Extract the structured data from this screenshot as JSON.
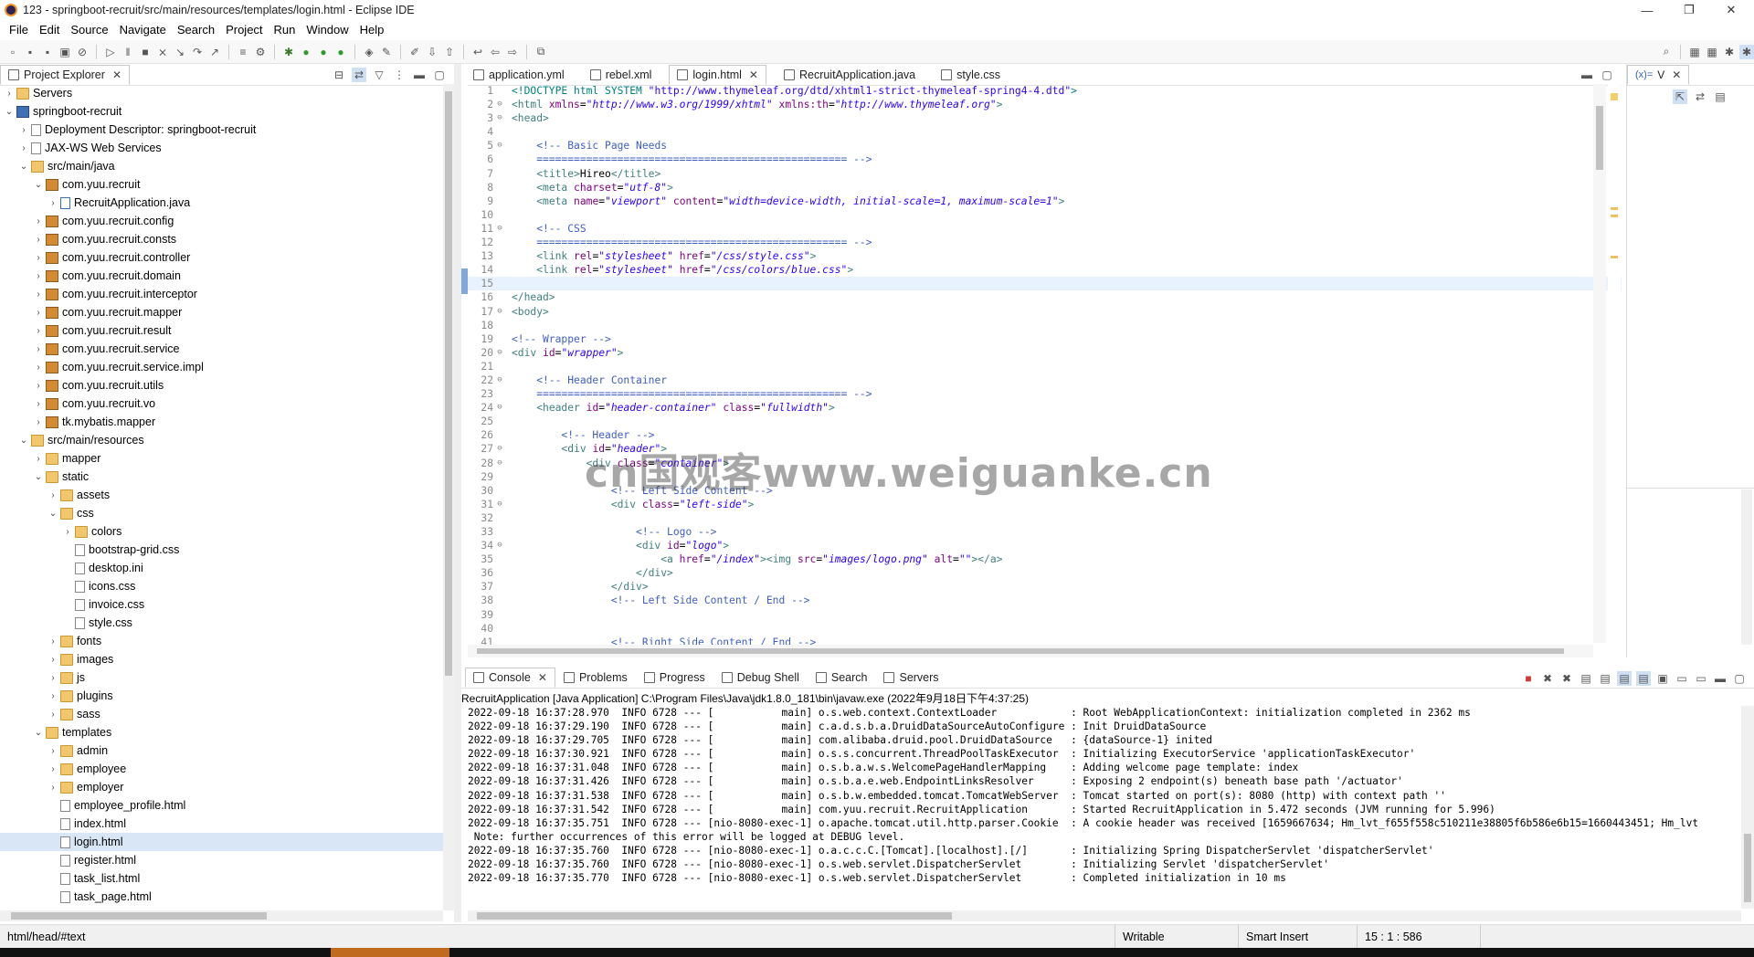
{
  "window": {
    "title": "123 - springboot-recruit/src/main/resources/templates/login.html - Eclipse IDE"
  },
  "menu": [
    "File",
    "Edit",
    "Source",
    "Navigate",
    "Search",
    "Project",
    "Run",
    "Window",
    "Help"
  ],
  "project_explorer": {
    "tab_label": "Project Explorer",
    "rows": [
      {
        "label": "Servers",
        "indent": 0,
        "arrow": "›",
        "icon": "folder"
      },
      {
        "label": "springboot-recruit",
        "indent": 0,
        "arrow": "⌄",
        "icon": "proj"
      },
      {
        "label": "Deployment Descriptor: springboot-recruit",
        "indent": 1,
        "arrow": "›",
        "icon": "file"
      },
      {
        "label": "JAX-WS Web Services",
        "indent": 1,
        "arrow": "›",
        "icon": "file"
      },
      {
        "label": "src/main/java",
        "indent": 1,
        "arrow": "⌄",
        "icon": "src"
      },
      {
        "label": "com.yuu.recruit",
        "indent": 2,
        "arrow": "⌄",
        "icon": "pkg"
      },
      {
        "label": "RecruitApplication.java",
        "indent": 3,
        "arrow": "›",
        "icon": "java"
      },
      {
        "label": "com.yuu.recruit.config",
        "indent": 2,
        "arrow": "›",
        "icon": "pkg"
      },
      {
        "label": "com.yuu.recruit.consts",
        "indent": 2,
        "arrow": "›",
        "icon": "pkg"
      },
      {
        "label": "com.yuu.recruit.controller",
        "indent": 2,
        "arrow": "›",
        "icon": "pkg"
      },
      {
        "label": "com.yuu.recruit.domain",
        "indent": 2,
        "arrow": "›",
        "icon": "pkg"
      },
      {
        "label": "com.yuu.recruit.interceptor",
        "indent": 2,
        "arrow": "›",
        "icon": "pkg"
      },
      {
        "label": "com.yuu.recruit.mapper",
        "indent": 2,
        "arrow": "›",
        "icon": "pkg"
      },
      {
        "label": "com.yuu.recruit.result",
        "indent": 2,
        "arrow": "›",
        "icon": "pkg"
      },
      {
        "label": "com.yuu.recruit.service",
        "indent": 2,
        "arrow": "›",
        "icon": "pkg"
      },
      {
        "label": "com.yuu.recruit.service.impl",
        "indent": 2,
        "arrow": "›",
        "icon": "pkg"
      },
      {
        "label": "com.yuu.recruit.utils",
        "indent": 2,
        "arrow": "›",
        "icon": "pkg"
      },
      {
        "label": "com.yuu.recruit.vo",
        "indent": 2,
        "arrow": "›",
        "icon": "pkg"
      },
      {
        "label": "tk.mybatis.mapper",
        "indent": 2,
        "arrow": "›",
        "icon": "pkg"
      },
      {
        "label": "src/main/resources",
        "indent": 1,
        "arrow": "⌄",
        "icon": "src"
      },
      {
        "label": "mapper",
        "indent": 2,
        "arrow": "›",
        "icon": "folder"
      },
      {
        "label": "static",
        "indent": 2,
        "arrow": "⌄",
        "icon": "folder"
      },
      {
        "label": "assets",
        "indent": 3,
        "arrow": "›",
        "icon": "folder"
      },
      {
        "label": "css",
        "indent": 3,
        "arrow": "⌄",
        "icon": "folder"
      },
      {
        "label": "colors",
        "indent": 4,
        "arrow": "›",
        "icon": "folder"
      },
      {
        "label": "bootstrap-grid.css",
        "indent": 4,
        "arrow": "",
        "icon": "file"
      },
      {
        "label": "desktop.ini",
        "indent": 4,
        "arrow": "",
        "icon": "file"
      },
      {
        "label": "icons.css",
        "indent": 4,
        "arrow": "",
        "icon": "file"
      },
      {
        "label": "invoice.css",
        "indent": 4,
        "arrow": "",
        "icon": "file"
      },
      {
        "label": "style.css",
        "indent": 4,
        "arrow": "",
        "icon": "file"
      },
      {
        "label": "fonts",
        "indent": 3,
        "arrow": "›",
        "icon": "folder"
      },
      {
        "label": "images",
        "indent": 3,
        "arrow": "›",
        "icon": "folder"
      },
      {
        "label": "js",
        "indent": 3,
        "arrow": "›",
        "icon": "folder"
      },
      {
        "label": "plugins",
        "indent": 3,
        "arrow": "›",
        "icon": "folder"
      },
      {
        "label": "sass",
        "indent": 3,
        "arrow": "›",
        "icon": "folder"
      },
      {
        "label": "templates",
        "indent": 2,
        "arrow": "⌄",
        "icon": "folder"
      },
      {
        "label": "admin",
        "indent": 3,
        "arrow": "›",
        "icon": "folder"
      },
      {
        "label": "employee",
        "indent": 3,
        "arrow": "›",
        "icon": "folder"
      },
      {
        "label": "employer",
        "indent": 3,
        "arrow": "›",
        "icon": "folder"
      },
      {
        "label": "employee_profile.html",
        "indent": 3,
        "arrow": "",
        "icon": "file"
      },
      {
        "label": "index.html",
        "indent": 3,
        "arrow": "",
        "icon": "file"
      },
      {
        "label": "login.html",
        "indent": 3,
        "arrow": "",
        "icon": "file",
        "selected": true
      },
      {
        "label": "register.html",
        "indent": 3,
        "arrow": "",
        "icon": "file"
      },
      {
        "label": "task_list.html",
        "indent": 3,
        "arrow": "",
        "icon": "file"
      },
      {
        "label": "task_page.html",
        "indent": 3,
        "arrow": "",
        "icon": "file"
      }
    ]
  },
  "editor": {
    "tabs": [
      {
        "label": "application.yml",
        "active": false
      },
      {
        "label": "rebel.xml",
        "active": false
      },
      {
        "label": "login.html",
        "active": true
      },
      {
        "label": "RecruitApplication.java",
        "active": false
      },
      {
        "label": "style.css",
        "active": false
      }
    ],
    "lines": [
      {
        "n": "1",
        "f": "",
        "h": "<span class='dt'>&lt;!DOCTYPE html SYSTEM </span><span class='s' style='font-style:normal'>\"http://www.thymeleaf.org/dtd/xhtml1-strict-thymeleaf-spring4-4.dtd\"</span><span class='dt'>&gt;</span>"
      },
      {
        "n": "2",
        "f": "⊖",
        "h": "<span class='k'>&lt;html</span> <span class='a'>xmlns</span>=<span class='s'>\"http://www.w3.org/1999/xhtml\"</span> <span class='a'>xmlns:th</span>=<span class='s'>\"http://www.thymeleaf.org\"</span><span class='k'>&gt;</span>"
      },
      {
        "n": "3",
        "f": "⊖",
        "h": "<span class='k'>&lt;head&gt;</span>"
      },
      {
        "n": "4",
        "f": "",
        "h": ""
      },
      {
        "n": "5",
        "f": "⊖",
        "h": "    <span class='c'>&lt;!-- Basic Page Needs</span>"
      },
      {
        "n": "6",
        "f": "",
        "h": "    <span class='c'>================================================== --&gt;</span>"
      },
      {
        "n": "7",
        "f": "",
        "h": "    <span class='k'>&lt;title&gt;</span>Hireo<span class='k'>&lt;/title&gt;</span>"
      },
      {
        "n": "8",
        "f": "",
        "h": "    <span class='k'>&lt;meta</span> <span class='a'>charset</span>=<span class='s'>\"utf-8\"</span><span class='k'>&gt;</span>"
      },
      {
        "n": "9",
        "f": "",
        "h": "    <span class='k'>&lt;meta</span> <span class='a'>name</span>=<span class='s'>\"viewport\"</span> <span class='a'>content</span>=<span class='s'>\"width=device-width, initial-scale=1, maximum-scale=1\"</span><span class='k'>&gt;</span>"
      },
      {
        "n": "10",
        "f": "",
        "h": ""
      },
      {
        "n": "11",
        "f": "⊖",
        "h": "    <span class='c'>&lt;!-- CSS</span>"
      },
      {
        "n": "12",
        "f": "",
        "h": "    <span class='c'>================================================== --&gt;</span>"
      },
      {
        "n": "13",
        "f": "",
        "h": "    <span class='k'>&lt;link</span> <span class='a'>rel</span>=<span class='s'>\"stylesheet\"</span> <span class='a'>href</span>=<span class='s'>\"/css/style.css\"</span><span class='k'>&gt;</span>"
      },
      {
        "n": "14",
        "f": "",
        "h": "    <span class='k'>&lt;link</span> <span class='a'>rel</span>=<span class='s'>\"stylesheet\"</span> <span class='a'>href</span>=<span class='s'>\"/css/colors/blue.css\"</span><span class='k'>&gt;</span>"
      },
      {
        "n": "15",
        "f": "",
        "h": "",
        "cur": true
      },
      {
        "n": "16",
        "f": "",
        "h": "<span class='k'>&lt;/head&gt;</span>"
      },
      {
        "n": "17",
        "f": "⊖",
        "h": "<span class='k'>&lt;body&gt;</span>"
      },
      {
        "n": "18",
        "f": "",
        "h": ""
      },
      {
        "n": "19",
        "f": "",
        "h": "<span class='c'>&lt;!-- Wrapper --&gt;</span>"
      },
      {
        "n": "20",
        "f": "⊖",
        "h": "<span class='k'>&lt;div</span> <span class='a'>id</span>=<span class='s'>\"wrapper\"</span><span class='k'>&gt;</span>"
      },
      {
        "n": "21",
        "f": "",
        "h": ""
      },
      {
        "n": "22",
        "f": "⊖",
        "h": "    <span class='c'>&lt;!-- Header Container</span>"
      },
      {
        "n": "23",
        "f": "",
        "h": "    <span class='c'>================================================== --&gt;</span>"
      },
      {
        "n": "24",
        "f": "⊖",
        "h": "    <span class='k'>&lt;header</span> <span class='a'>id</span>=<span class='s'>\"header-container\"</span> <span class='a'>class</span>=<span class='s'>\"fullwidth\"</span><span class='k'>&gt;</span>"
      },
      {
        "n": "25",
        "f": "",
        "h": ""
      },
      {
        "n": "26",
        "f": "",
        "h": "        <span class='c'>&lt;!-- Header --&gt;</span>"
      },
      {
        "n": "27",
        "f": "⊖",
        "h": "        <span class='k'>&lt;div</span> <span class='a'>id</span>=<span class='s'>\"header\"</span><span class='k'>&gt;</span>"
      },
      {
        "n": "28",
        "f": "⊖",
        "h": "            <span class='k'>&lt;div</span> <span class='a'>class</span>=<span class='s'>\"container\"</span><span class='k'>&gt;</span>"
      },
      {
        "n": "29",
        "f": "",
        "h": ""
      },
      {
        "n": "30",
        "f": "",
        "h": "                <span class='c'>&lt;!-- Left Side Content --&gt;</span>"
      },
      {
        "n": "31",
        "f": "⊖",
        "h": "                <span class='k'>&lt;div</span> <span class='a'>class</span>=<span class='s'>\"left-side\"</span><span class='k'>&gt;</span>"
      },
      {
        "n": "32",
        "f": "",
        "h": ""
      },
      {
        "n": "33",
        "f": "",
        "h": "                    <span class='c'>&lt;!-- Logo --&gt;</span>"
      },
      {
        "n": "34",
        "f": "⊖",
        "h": "                    <span class='k'>&lt;div</span> <span class='a'>id</span>=<span class='s'>\"logo\"</span><span class='k'>&gt;</span>"
      },
      {
        "n": "35",
        "f": "",
        "h": "                        <span class='k'>&lt;a</span> <span class='a'>href</span>=<span class='s'>\"/index\"</span><span class='k'>&gt;&lt;img</span> <span class='a'>src</span>=<span class='s'>\"images/logo.png\"</span> <span class='a'>alt</span>=<span class='s'>\"\"</span><span class='k'>&gt;&lt;/a&gt;</span>"
      },
      {
        "n": "36",
        "f": "",
        "h": "                    <span class='k'>&lt;/div&gt;</span>"
      },
      {
        "n": "37",
        "f": "",
        "h": "                <span class='k'>&lt;/div&gt;</span>"
      },
      {
        "n": "38",
        "f": "",
        "h": "                <span class='c'>&lt;!-- Left Side Content / End --&gt;</span>"
      },
      {
        "n": "39",
        "f": "",
        "h": ""
      },
      {
        "n": "40",
        "f": "",
        "h": ""
      },
      {
        "n": "41",
        "f": "",
        "h": "                <span class='c'>&lt;!-- Right Side Content / End --&gt;</span>"
      }
    ]
  },
  "bottom_panel": {
    "tabs": [
      "Console",
      "Problems",
      "Progress",
      "Debug Shell",
      "Search",
      "Servers"
    ],
    "header": "RecruitApplication [Java Application] C:\\Program Files\\Java\\jdk1.8.0_181\\bin\\javaw.exe  (2022年9月18日下午4:37:25)",
    "lines": [
      "2022-09-18 16:37:28.970  INFO 6728 --- [           main] o.s.web.context.ContextLoader            : Root WebApplicationContext: initialization completed in 2362 ms",
      "2022-09-18 16:37:29.190  INFO 6728 --- [           main] c.a.d.s.b.a.DruidDataSourceAutoConfigure : Init DruidDataSource",
      "2022-09-18 16:37:29.705  INFO 6728 --- [           main] com.alibaba.druid.pool.DruidDataSource   : {dataSource-1} inited",
      "2022-09-18 16:37:30.921  INFO 6728 --- [           main] o.s.s.concurrent.ThreadPoolTaskExecutor  : Initializing ExecutorService 'applicationTaskExecutor'",
      "2022-09-18 16:37:31.048  INFO 6728 --- [           main] o.s.b.a.w.s.WelcomePageHandlerMapping    : Adding welcome page template: index",
      "2022-09-18 16:37:31.426  INFO 6728 --- [           main] o.s.b.a.e.web.EndpointLinksResolver      : Exposing 2 endpoint(s) beneath base path '/actuator'",
      "2022-09-18 16:37:31.538  INFO 6728 --- [           main] o.s.b.w.embedded.tomcat.TomcatWebServer  : Tomcat started on port(s): 8080 (http) with context path ''",
      "2022-09-18 16:37:31.542  INFO 6728 --- [           main] com.yuu.recruit.RecruitApplication       : Started RecruitApplication in 5.472 seconds (JVM running for 5.996)",
      "2022-09-18 16:37:35.751  INFO 6728 --- [nio-8080-exec-1] o.apache.tomcat.util.http.parser.Cookie  : A cookie header was received [1659667634; Hm_lvt_f655f558c510211e38805f6b586e6b15=1660443451; Hm_lvt",
      " Note: further occurrences of this error will be logged at DEBUG level.",
      "2022-09-18 16:37:35.760  INFO 6728 --- [nio-8080-exec-1] o.a.c.c.C.[Tomcat].[localhost].[/]       : Initializing Spring DispatcherServlet 'dispatcherServlet'",
      "2022-09-18 16:37:35.760  INFO 6728 --- [nio-8080-exec-1] o.s.web.servlet.DispatcherServlet        : Initializing Servlet 'dispatcherServlet'",
      "2022-09-18 16:37:35.770  INFO 6728 --- [nio-8080-exec-1] o.s.web.servlet.DispatcherServlet        : Completed initialization in 10 ms"
    ]
  },
  "status": {
    "path": "html/head/#text",
    "mode": "Writable",
    "insert": "Smart Insert",
    "position": "15 : 1 : 586"
  },
  "watermark": "cn国观客www.weiguanke.cn"
}
